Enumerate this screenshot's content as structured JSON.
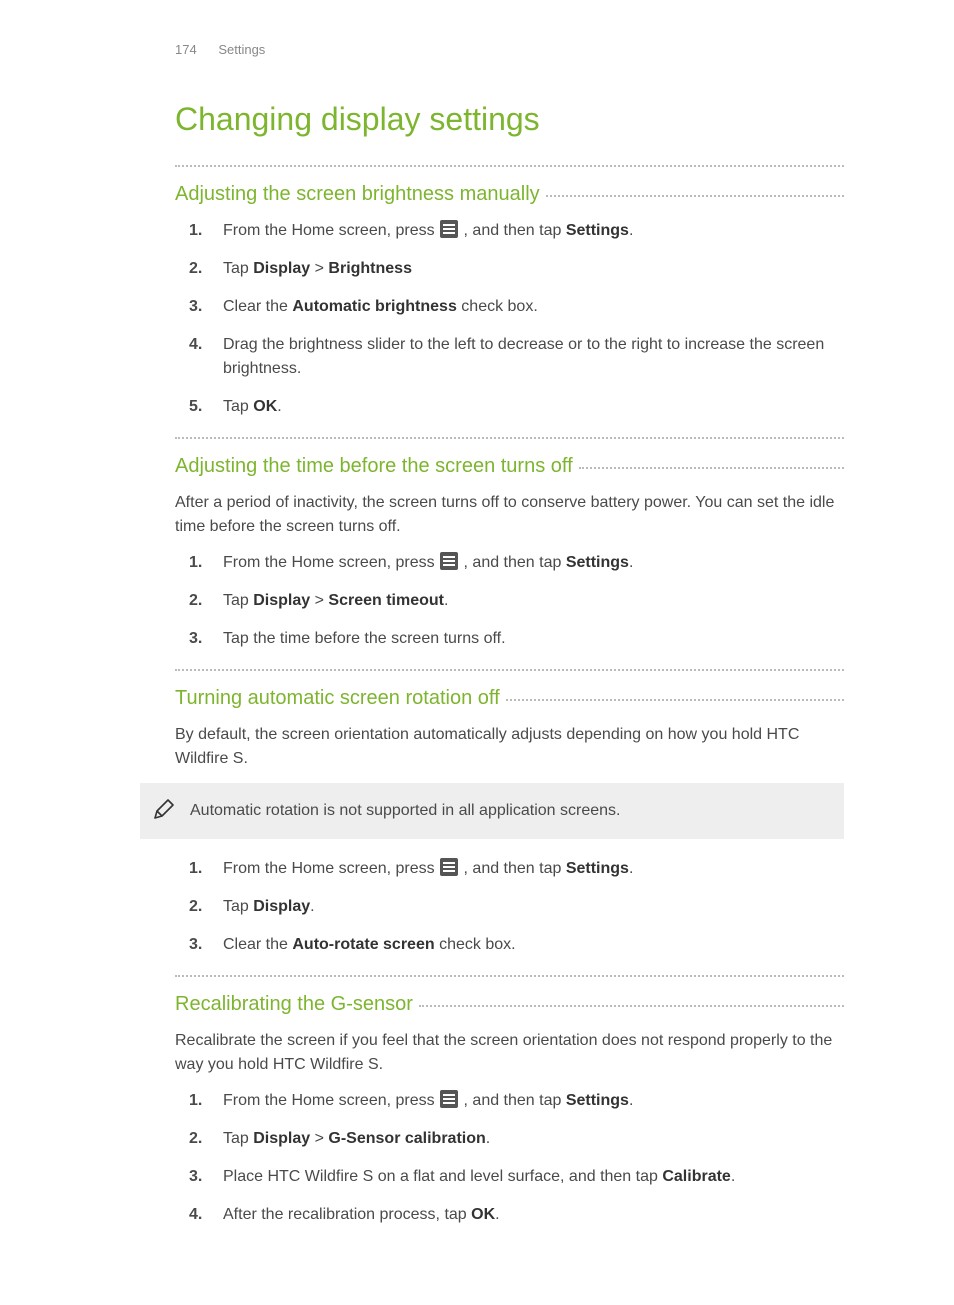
{
  "header": {
    "page_number": "174",
    "section_name": "Settings"
  },
  "title": "Changing display settings",
  "sections": [
    {
      "heading": "Adjusting the screen brightness manually",
      "steps": {
        "s1_pre": "From the Home screen, press ",
        "s1_post": " , and then tap ",
        "s1_bold": "Settings",
        "s1_end": ".",
        "s2_pre": "Tap ",
        "s2_b1": "Display",
        "s2_mid": " > ",
        "s2_b2": "Brightness",
        "s3_pre": "Clear the ",
        "s3_b1": "Automatic brightness",
        "s3_post": " check box.",
        "s4": "Drag the brightness slider to the left to decrease or to the right to increase the screen brightness.",
        "s5_pre": "Tap ",
        "s5_b1": "OK",
        "s5_post": "."
      }
    },
    {
      "heading": "Adjusting the time before the screen turns off",
      "intro": "After a period of inactivity, the screen turns off to conserve battery power. You can set the idle time before the screen turns off.",
      "steps": {
        "s1_pre": "From the Home screen, press ",
        "s1_post": " , and then tap ",
        "s1_bold": "Settings",
        "s1_end": ".",
        "s2_pre": "Tap ",
        "s2_b1": "Display",
        "s2_mid": " > ",
        "s2_b2": "Screen timeout",
        "s2_post": ".",
        "s3": "Tap the time before the screen turns off."
      }
    },
    {
      "heading": "Turning automatic screen rotation off",
      "intro": "By default, the screen orientation automatically adjusts depending on how you hold HTC Wildfire S.",
      "note": "Automatic rotation is not supported in all application screens.",
      "steps": {
        "s1_pre": "From the Home screen, press ",
        "s1_post": " , and then tap ",
        "s1_bold": "Settings",
        "s1_end": ".",
        "s2_pre": "Tap ",
        "s2_b1": "Display",
        "s2_post": ".",
        "s3_pre": "Clear the ",
        "s3_b1": "Auto-rotate screen",
        "s3_post": " check box."
      }
    },
    {
      "heading": "Recalibrating the G-sensor",
      "intro": "Recalibrate the screen if you feel that the screen orientation does not respond properly to the way you hold HTC Wildfire S.",
      "steps": {
        "s1_pre": "From the Home screen, press ",
        "s1_post": " , and then tap ",
        "s1_bold": "Settings",
        "s1_end": ".",
        "s2_pre": "Tap ",
        "s2_b1": "Display",
        "s2_mid": " > ",
        "s2_b2": "G-Sensor calibration",
        "s2_post": ".",
        "s3_pre": "Place HTC Wildfire S on a flat and level surface, and then tap ",
        "s3_b1": "Calibrate",
        "s3_post": ".",
        "s4_pre": "After the recalibration process, tap ",
        "s4_b1": "OK",
        "s4_post": "."
      }
    }
  ]
}
